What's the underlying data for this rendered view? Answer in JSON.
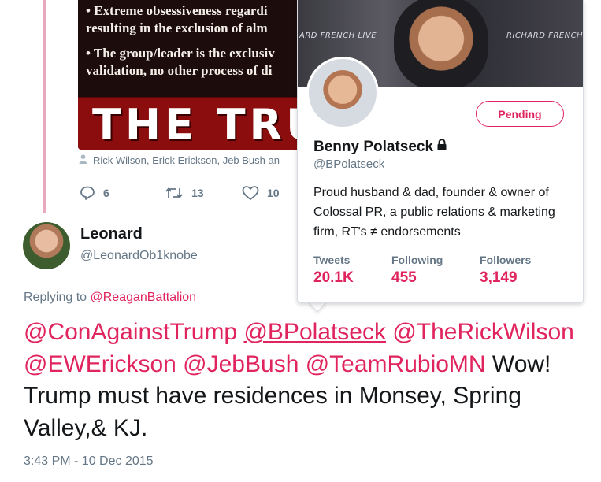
{
  "context_tweet": {
    "media": {
      "lines": [
        "• Extreme obsessiveness regardi",
        "resulting in the exclusion of alm",
        "",
        "• The group/leader is the exclusiv",
        "validation, no other process of di"
      ],
      "banner_text": "THE TRU"
    },
    "tagged_people": "Rick Wilson, Erick Erickson, Jeb Bush an",
    "actions": {
      "replies": "6",
      "retweets": "13",
      "likes": "10"
    }
  },
  "tweet": {
    "author_name": "Leonard",
    "author_handle": "@LeonardOb1knobe",
    "replying_to_label": "Replying to",
    "replying_to_handle": "@ReaganBattalion",
    "mentions": [
      "@ConAgainstTrump",
      "@BPolatseck",
      "@TheRickWilson",
      "@EWErickson",
      "@JebBush",
      "@TeamRubioMN"
    ],
    "body": "Wow! Trump must have residences in Monsey, Spring Valley,& KJ.",
    "timestamp": "3:43 PM - 10 Dec 2015"
  },
  "hovercard": {
    "banner_label_left": "ARD FRENCH LIVE",
    "banner_label_right": "RICHARD FRENCH LIVE",
    "follow_state": "Pending",
    "name": "Benny Polatseck",
    "handle": "@BPolatseck",
    "bio": "Proud husband & dad, founder & owner of Colossal PR, a public relations & marketing firm, RT's ≠ endorsements",
    "stats": [
      {
        "label": "Tweets",
        "value": "20.1K"
      },
      {
        "label": "Following",
        "value": "455"
      },
      {
        "label": "Followers",
        "value": "3,149"
      }
    ],
    "accent_color": "#e0245e"
  },
  "icons": [
    "person-icon",
    "reply-icon",
    "retweet-icon",
    "like-icon",
    "lock-icon"
  ]
}
